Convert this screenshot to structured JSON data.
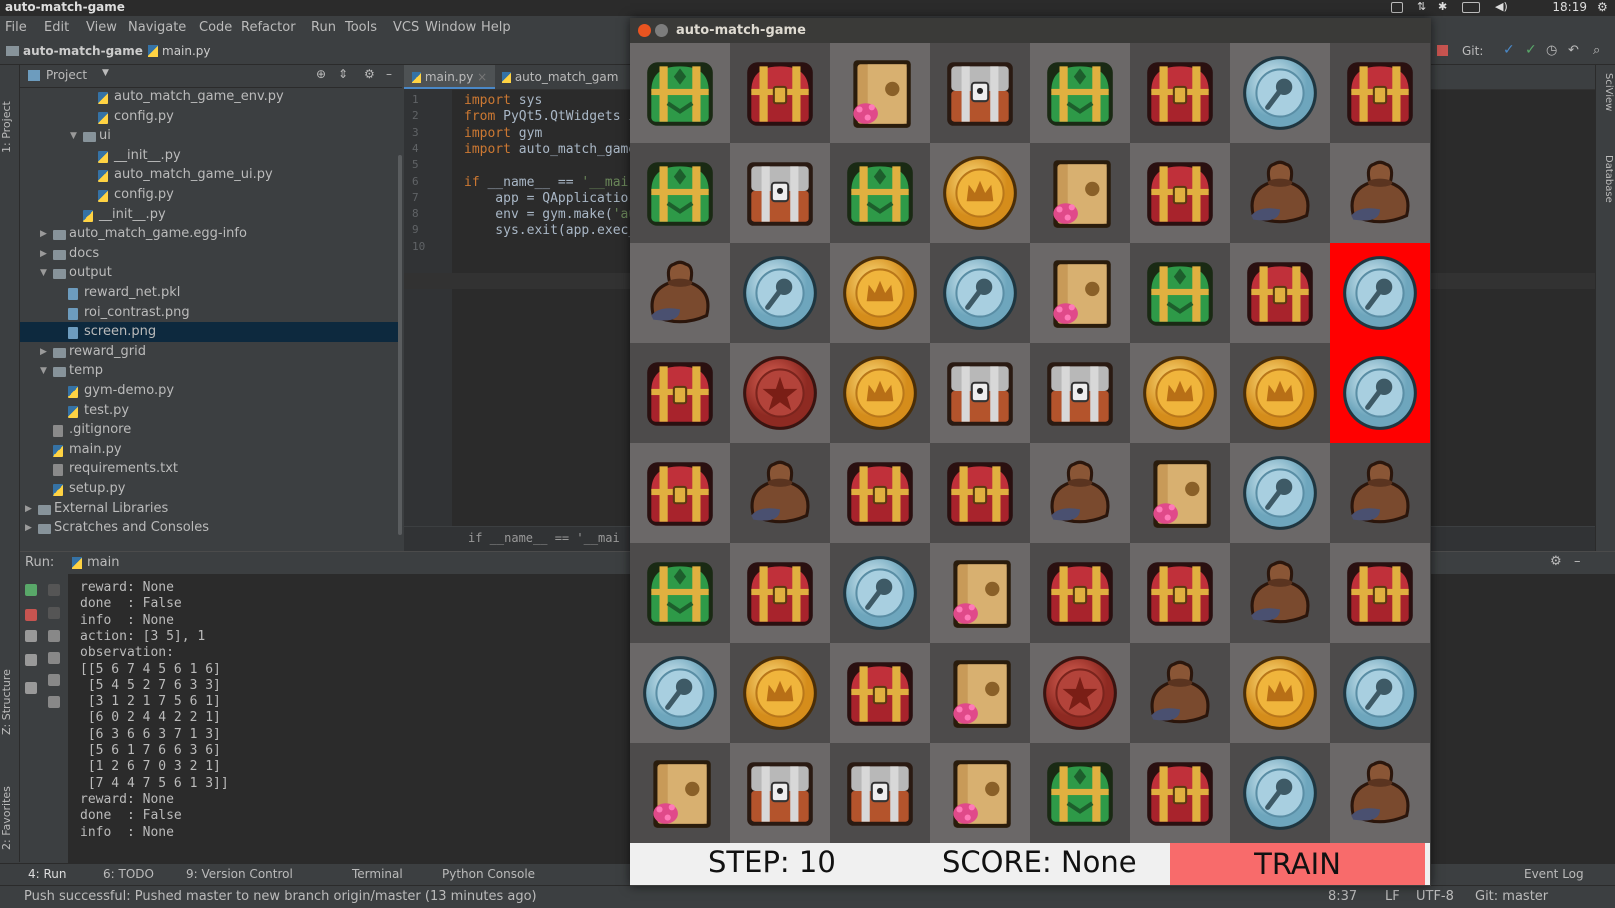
{
  "system": {
    "window_title": "auto-match-game",
    "clock": "18:19"
  },
  "menu": [
    "File",
    "Edit",
    "View",
    "Navigate",
    "Code",
    "Refactor",
    "Run",
    "Tools",
    "VCS",
    "Window",
    "Help"
  ],
  "navbar": {
    "project": "auto-match-game",
    "file": "main.py",
    "git_label": "Git:"
  },
  "left_tool_tabs": {
    "project": "1: Project",
    "structure": "Z: Structure",
    "favorites": "2: Favorites"
  },
  "right_tool_tabs": {
    "sciview": "SciView",
    "database": "Database"
  },
  "project_panel": {
    "title": "Project",
    "tree": [
      {
        "label": "auto_match_game_env.py",
        "kind": "py",
        "indent": 4
      },
      {
        "label": "config.py",
        "kind": "py",
        "indent": 4
      },
      {
        "label": "ui",
        "kind": "folder",
        "indent": 3,
        "arrow": "open"
      },
      {
        "label": "__init__.py",
        "kind": "py",
        "indent": 4
      },
      {
        "label": "auto_match_game_ui.py",
        "kind": "py",
        "indent": 4
      },
      {
        "label": "config.py",
        "kind": "py",
        "indent": 4
      },
      {
        "label": "__init__.py",
        "kind": "py",
        "indent": 3
      },
      {
        "label": "auto_match_game.egg-info",
        "kind": "folder",
        "indent": 1,
        "arrow": "closed"
      },
      {
        "label": "docs",
        "kind": "folder",
        "indent": 1,
        "arrow": "closed"
      },
      {
        "label": "output",
        "kind": "folder",
        "indent": 1,
        "arrow": "open"
      },
      {
        "label": "reward_net.pkl",
        "kind": "file",
        "indent": 2
      },
      {
        "label": "roi_contrast.png",
        "kind": "file",
        "indent": 2
      },
      {
        "label": "screen.png",
        "kind": "file",
        "indent": 2,
        "selected": true
      },
      {
        "label": "reward_grid",
        "kind": "folder",
        "indent": 1,
        "arrow": "closed"
      },
      {
        "label": "temp",
        "kind": "folder",
        "indent": 1,
        "arrow": "open"
      },
      {
        "label": "gym-demo.py",
        "kind": "py",
        "indent": 2
      },
      {
        "label": "test.py",
        "kind": "py",
        "indent": 2
      },
      {
        "label": ".gitignore",
        "kind": "txt",
        "indent": 1
      },
      {
        "label": "main.py",
        "kind": "py",
        "indent": 1
      },
      {
        "label": "requirements.txt",
        "kind": "txt",
        "indent": 1
      },
      {
        "label": "setup.py",
        "kind": "py",
        "indent": 1
      },
      {
        "label": "External Libraries",
        "kind": "lib",
        "indent": 0,
        "arrow": "closed"
      },
      {
        "label": "Scratches and Consoles",
        "kind": "lib",
        "indent": 0,
        "arrow": "closed"
      }
    ]
  },
  "editor": {
    "tabs": [
      {
        "label": "main.py",
        "active": true
      },
      {
        "label": "auto_match_gam",
        "active": false
      }
    ],
    "line_numbers": [
      "1",
      "2",
      "3",
      "4",
      "5",
      "6",
      "7",
      "8",
      "9",
      "10"
    ],
    "lines": [
      {
        "kw": "import",
        "rest": " sys"
      },
      {
        "kw": "from",
        "rest": " PyQt5.QtWidgets i"
      },
      {
        "kw": "import",
        "rest": " gym"
      },
      {
        "kw": "import",
        "rest": " auto_match_game"
      },
      {
        "kw": "",
        "rest": ""
      },
      {
        "kw": "if",
        "rest": " __name__ == '__mai"
      },
      {
        "kw": "",
        "rest": "    app = QApplicatio"
      },
      {
        "kw": "",
        "rest": "    env = gym.make('au"
      },
      {
        "kw": "",
        "rest": "    sys.exit(app.exec_"
      },
      {
        "kw": "",
        "rest": ""
      }
    ],
    "breadcrumb": "if __name__ == '__mai"
  },
  "run_panel": {
    "label": "Run:",
    "config": "main",
    "console": [
      "reward: None",
      "done  : False",
      "info  : None",
      "action: [3 5], 1",
      "observation:",
      "[[5 6 7 4 5 6 1 6]",
      " [5 4 5 2 7 6 3 3]",
      " [3 1 2 1 7 5 6 1]",
      " [6 0 2 4 4 2 2 1]",
      " [6 3 6 6 3 7 1 3]",
      " [5 6 1 7 6 6 3 6]",
      " [1 2 6 7 0 3 2 1]",
      " [7 4 4 7 5 6 1 3]]",
      "reward: None",
      "done  : False",
      "info  : None"
    ]
  },
  "bottom_tabs": {
    "run": "4: Run",
    "todo": "6: TODO",
    "vcs": "9: Version Control",
    "terminal": "Terminal",
    "python_console": "Python Console",
    "event_log": "Event Log"
  },
  "status_bar": {
    "message": "Push successful: Pushed master to new branch origin/master (13 minutes ago)",
    "position": "8:37",
    "line_sep": "LF",
    "encoding": "UTF-8",
    "git_branch": "Git: master"
  },
  "game": {
    "title": "auto-match-game",
    "board": [
      [
        5,
        6,
        7,
        4,
        5,
        6,
        1,
        6
      ],
      [
        5,
        4,
        5,
        2,
        7,
        6,
        3,
        3
      ],
      [
        3,
        1,
        2,
        1,
        7,
        5,
        6,
        1
      ],
      [
        6,
        0,
        2,
        4,
        4,
        2,
        2,
        1
      ],
      [
        6,
        3,
        6,
        6,
        3,
        7,
        1,
        3
      ],
      [
        5,
        6,
        1,
        7,
        6,
        6,
        3,
        6
      ],
      [
        1,
        2,
        6,
        7,
        0,
        3,
        2,
        1
      ],
      [
        7,
        4,
        4,
        7,
        5,
        6,
        1,
        3
      ]
    ],
    "highlighted": [
      [
        2,
        7
      ],
      [
        3,
        7
      ]
    ],
    "piece_names": [
      "red-coin",
      "blue-coin",
      "gold-coin",
      "brown-bag",
      "steel-chest",
      "green-chest",
      "red-chest",
      "gold-vault"
    ],
    "colors": {
      "highlight": "#ff0000",
      "light_cell": "#6b6868",
      "dark_cell": "#4d4b4b",
      "train_button": "#f86b6b"
    },
    "step_label": "STEP: 10",
    "score_label": "SCORE: None",
    "train_label": "TRAIN"
  }
}
